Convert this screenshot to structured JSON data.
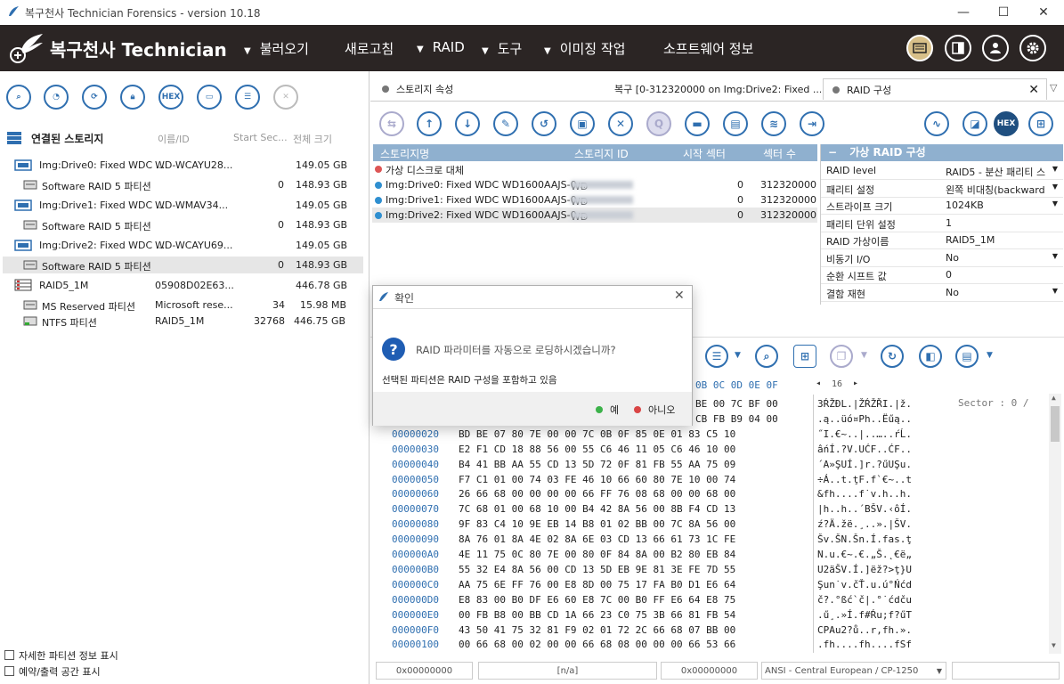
{
  "window": {
    "title": "복구천사 Technician Forensics - version 10.18",
    "minimize": "—",
    "maximize": "☐",
    "close": "✕"
  },
  "brand": {
    "name": "복구천사 Technician"
  },
  "menu": [
    {
      "label": "불러오기",
      "arrow": "▼"
    },
    {
      "label": "새로고침",
      "arrow": ""
    },
    {
      "label": "RAID",
      "arrow": "▼"
    },
    {
      "label": "도구",
      "arrow": "▼"
    },
    {
      "label": "이미징 작업",
      "arrow": "▼"
    },
    {
      "label": "소프트웨어 정보",
      "arrow": ""
    }
  ],
  "left": {
    "section_title": "연결된 스토리지",
    "col_name": "이름/ID",
    "col_start": "Start Sec...",
    "col_size": "전체 크기",
    "rows": [
      {
        "name": "Img:Drive0: Fixed WDC ...",
        "id": "WD-WCAYU28...",
        "start": "",
        "size": "149.05 GB"
      },
      {
        "name": "Software RAID 5 파티션",
        "id": "",
        "start": "0",
        "size": "148.93 GB"
      },
      {
        "name": "Img:Drive1: Fixed WDC ...",
        "id": "WD-WMAV34...",
        "start": "",
        "size": "149.05 GB"
      },
      {
        "name": "Software RAID 5 파티션",
        "id": "",
        "start": "0",
        "size": "148.93 GB"
      },
      {
        "name": "Img:Drive2: Fixed WDC ...",
        "id": "WD-WCAYU69...",
        "start": "",
        "size": "149.05 GB"
      },
      {
        "name": "Software RAID 5 파티션",
        "id": "",
        "start": "0",
        "size": "148.93 GB"
      },
      {
        "name": "RAID5_1M",
        "id": "05908D02E63...",
        "start": "",
        "size": "446.78 GB"
      },
      {
        "name": "MS Reserved 파티션",
        "id": "Microsoft rese...",
        "start": "34",
        "size": "15.98 MB"
      },
      {
        "name": "NTFS 파티션",
        "id": "RAID5_1M",
        "start": "32768",
        "size": "446.75 GB"
      }
    ],
    "check1": "자세한 파티션 정보 표시",
    "check2": "예약/출력 공간 표시",
    "hex_label": "HEX"
  },
  "tabs": [
    {
      "label": "스토리지 속성"
    },
    {
      "label": "복구 [0-312320000 on Img:Drive2: Fixed ..."
    },
    {
      "label": "RAID 구성"
    }
  ],
  "storage_table": {
    "headers": [
      "스토리지명",
      "스토리지 ID",
      "시작 섹터",
      "섹터 수"
    ],
    "rows": [
      {
        "name": "가상 디스크로 대체",
        "id": "",
        "start": "",
        "count": ""
      },
      {
        "name": "Img:Drive0: Fixed WDC WD1600AAJS-0...",
        "id": "WD",
        "start": "0",
        "count": "312320000"
      },
      {
        "name": "Img:Drive1: Fixed WDC WD1600AAJS-0...",
        "id": "WD",
        "start": "0",
        "count": "312320000"
      },
      {
        "name": "Img:Drive2: Fixed WDC WD1600AAJS-0...",
        "id": "WD",
        "start": "0",
        "count": "312320000"
      }
    ]
  },
  "raid_config": {
    "header": "가상 RAID 구성",
    "props": [
      {
        "key": "RAID level",
        "value": "RAID5 - 분산 패리티 스",
        "dropdown": true
      },
      {
        "key": "패리티 설정",
        "value": "왼쪽 비대칭(backward",
        "dropdown": true
      },
      {
        "key": "스트라이프 크기",
        "value": "1024KB",
        "dropdown": true
      },
      {
        "key": "패리티 단위 설정",
        "value": "1",
        "dropdown": false
      },
      {
        "key": "RAID 가상이름",
        "value": "RAID5_1M",
        "dropdown": false
      },
      {
        "key": "비동기 I/O",
        "value": "No",
        "dropdown": true
      },
      {
        "key": "순환 시프트 값",
        "value": "0",
        "dropdown": false
      },
      {
        "key": "결함 재현",
        "value": "No",
        "dropdown": true
      }
    ]
  },
  "hex": {
    "page": "16",
    "header_tail": "0B 0C 0D 0E 0F",
    "sector_label": "Sector : 0 /",
    "lines": [
      {
        "addr": "",
        "bytes": "BE 00 7C BF 00",
        "ascii": "3ŔŽĐL.|ŽŔŽŘI.|ž."
      },
      {
        "addr": "",
        "bytes": "CB FB B9 04 00",
        "ascii": ".ą..üó¤Ph..Ëűą.."
      },
      {
        "addr": "00000020",
        "bytes": "BD BE 07 80 7E 00 00 7C 0B 0F 85 0E 01 83 C5 10",
        "ascii": "˝I.€~..|..…..ŕĹ."
      },
      {
        "addr": "00000030",
        "bytes": "E2 F1 CD 18 88 56 00 55 C6 46 11 05 C6 46 10 00",
        "ascii": "âńÍ.?V.UĆF..ĆF.."
      },
      {
        "addr": "00000040",
        "bytes": "B4 41 BB AA 55 CD 13 5D 72 0F 81 FB 55 AA 75 09",
        "ascii": "´A»ŞUÍ.]r.?űUŞu."
      },
      {
        "addr": "00000050",
        "bytes": "F7 C1 01 00 74 03 FE 46 10 66 60 80 7E 10 00 74",
        "ascii": "÷Á..t.ţF.f`€~..t"
      },
      {
        "addr": "00000060",
        "bytes": "26 66 68 00 00 00 00 66 FF 76 08 68 00 00 68 00",
        "ascii": "&fh....f˙v.h..h."
      },
      {
        "addr": "00000070",
        "bytes": "7C 68 01 00 68 10 00 B4 42 8A 56 00 8B F4 CD 13",
        "ascii": "|h..h..´BŠV.‹ôÍ."
      },
      {
        "addr": "00000080",
        "bytes": "9F 83 C4 10 9E EB 14 B8 01 02 BB 00 7C 8A 56 00",
        "ascii": "ź?Ä.žë.¸..».|ŠV."
      },
      {
        "addr": "00000090",
        "bytes": "8A 76 01 8A 4E 02 8A 6E 03 CD 13 66 61 73 1C FE",
        "ascii": "Šv.ŠN.Šn.Í.fas.ţ"
      },
      {
        "addr": "000000A0",
        "bytes": "4E 11 75 0C 80 7E 00 80 0F 84 8A 00 B2 80 EB 84",
        "ascii": "N.u.€~.€.„Š.˛€ë„"
      },
      {
        "addr": "000000B0",
        "bytes": "55 32 E4 8A 56 00 CD 13 5D EB 9E 81 3E FE 7D 55",
        "ascii": "U2äŠV.Í.]ëž?>ţ}U"
      },
      {
        "addr": "000000C0",
        "bytes": "AA 75 6E FF 76 00 E8 8D 00 75 17 FA B0 D1 E6 64",
        "ascii": "Şun˙v.čŤ.u.ú°Ńćd"
      },
      {
        "addr": "000000D0",
        "bytes": "E8 83 00 B0 DF E6 60 E8 7C 00 B0 FF E6 64 E8 75",
        "ascii": "č?.°ßć`č|.°˙ćdču"
      },
      {
        "addr": "000000E0",
        "bytes": "00 FB B8 00 BB CD 1A 66 23 C0 75 3B 66 81 FB 54",
        "ascii": ".ű¸.»Í.f#Ŕu;f?űT"
      },
      {
        "addr": "000000F0",
        "bytes": "43 50 41 75 32 81 F9 02 01 72 2C 66 68 07 BB 00",
        "ascii": "CPAu2?ů..r,fh.»."
      },
      {
        "addr": "00000100",
        "bytes": "00 66 68 00 02 00 00 66 68 08 00 00 00 66 53 66",
        "ascii": ".fh....fh....fSf"
      }
    ]
  },
  "status": {
    "s1": "0x00000000",
    "s2": "[n/a]",
    "s3": "0x00000000",
    "s4": "ANSI - Central European / CP-1250"
  },
  "dialog": {
    "title": "확인",
    "question": "RAID 파라미터를 자동으로 로딩하시겠습니까?",
    "message": "선택된 파티션은 RAID 구성을 포함하고 있음",
    "yes": "예",
    "no": "아니오"
  }
}
